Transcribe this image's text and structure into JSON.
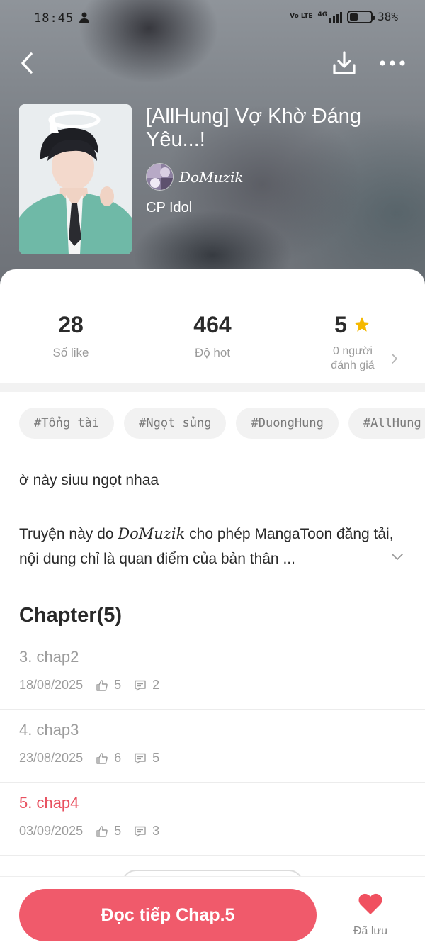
{
  "status_bar": {
    "time": "18:45",
    "network": "4G",
    "volte": "Vo LTE",
    "battery": "38%"
  },
  "header": {
    "title": "[AllHung] Vợ Khờ Đáng Yêu...!",
    "author": "DoMuzik",
    "category": "CP Idol",
    "icons": [
      "back-icon",
      "download-icon",
      "more-icon"
    ]
  },
  "stats": {
    "likes_value": "28",
    "likes_label": "Số like",
    "hot_value": "464",
    "hot_label": "Độ hot",
    "rating_value": "5",
    "rating_label_line1": "0 người",
    "rating_label_line2": "đánh giá"
  },
  "tags": [
    "#Tổng tài",
    "#Ngọt sủng",
    "#DuongHung",
    "#AllHung"
  ],
  "description": {
    "line1": "ờ này siuu ngọt nhaa",
    "prefix": "Truyện này do ",
    "author": "DoMuzik",
    "suffix": " cho phép MangaToon đăng tải, nội dung chỉ là quan điểm của bản thân ..."
  },
  "chapters": {
    "heading": "Chapter(5)",
    "items": [
      {
        "title": "3. chap2",
        "date": "18/08/2025",
        "likes": "5",
        "comments": "2",
        "current": false
      },
      {
        "title": "4. chap3",
        "date": "23/08/2025",
        "likes": "6",
        "comments": "5",
        "current": false
      },
      {
        "title": "5. chap4",
        "date": "03/09/2025",
        "likes": "5",
        "comments": "3",
        "current": true
      }
    ]
  },
  "bottom_bar": {
    "read_button": "Đọc tiếp Chap.5",
    "saved_label": "Đã lưu"
  },
  "colors": {
    "accent": "#f05a6b",
    "current_chapter": "#e8505f",
    "star": "#f5b800",
    "muted": "#9c9c9c"
  }
}
